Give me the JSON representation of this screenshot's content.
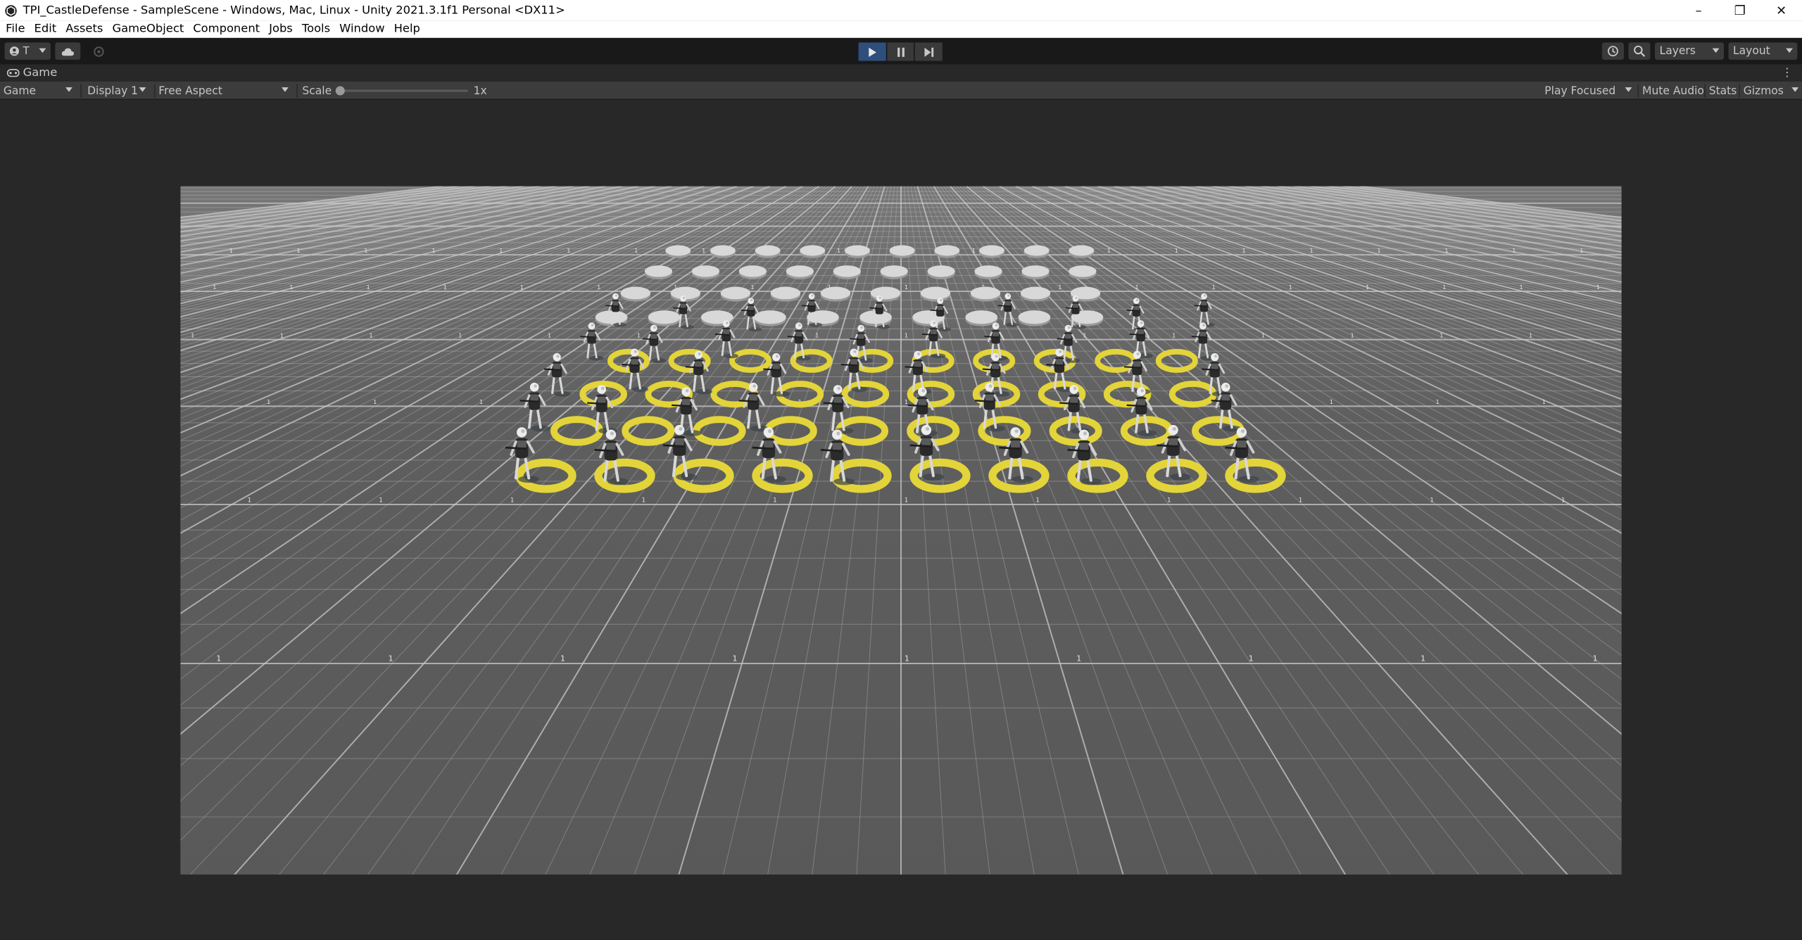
{
  "window": {
    "title": "TPI_CastleDefense - SampleScene - Windows, Mac, Linux - Unity 2021.3.1f1 Personal <DX11>",
    "minimize": "–",
    "restore": "❐",
    "close": "✕"
  },
  "menu": {
    "items": [
      "File",
      "Edit",
      "Assets",
      "GameObject",
      "Component",
      "Jobs",
      "Tools",
      "Window",
      "Help"
    ]
  },
  "toolbar": {
    "account_label": "T",
    "layers_label": "Layers",
    "layout_label": "Layout",
    "play_state": "playing"
  },
  "game_tab": {
    "label": "Game"
  },
  "game_toolbar": {
    "view_mode": "Game",
    "display": "Display 1",
    "aspect": "Free Aspect",
    "scale_label": "Scale",
    "scale_value": "1x",
    "play_mode": "Play Focused",
    "mute_audio": "Mute Audio",
    "stats": "Stats",
    "gizmos": "Gizmos"
  },
  "scene": {
    "ground_color": "#5a5a5a",
    "grid_color": "#c9c9c9",
    "ring_color": "#e3d43a",
    "disc_color": "#d8d8d8",
    "tile_mark": "1"
  }
}
